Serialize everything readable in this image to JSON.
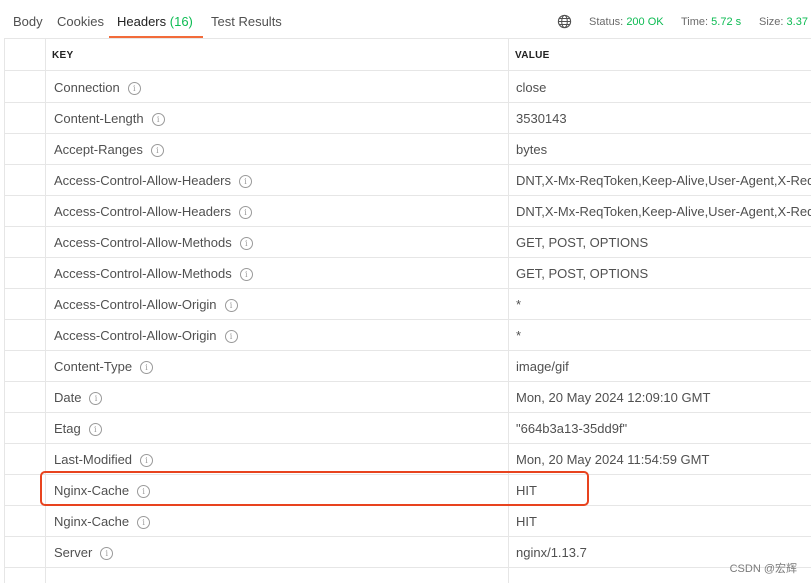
{
  "tabs": {
    "body": "Body",
    "cookies": "Cookies",
    "headers": "Headers",
    "headers_count": "(16)",
    "test_results": "Test Results"
  },
  "status": {
    "status_label": "Status:",
    "status_value": "200 OK",
    "time_label": "Time:",
    "time_value": "5.72 s",
    "size_label": "Size:",
    "size_value": "3.37"
  },
  "table": {
    "key_header": "KEY",
    "value_header": "VALUE",
    "rows": [
      {
        "key": "Connection",
        "value": "close"
      },
      {
        "key": "Content-Length",
        "value": "3530143"
      },
      {
        "key": "Accept-Ranges",
        "value": "bytes"
      },
      {
        "key": "Access-Control-Allow-Headers",
        "value": "DNT,X-Mx-ReqToken,Keep-Alive,User-Agent,X-Reques"
      },
      {
        "key": "Access-Control-Allow-Headers",
        "value": "DNT,X-Mx-ReqToken,Keep-Alive,User-Agent,X-Reques"
      },
      {
        "key": "Access-Control-Allow-Methods",
        "value": "GET, POST, OPTIONS"
      },
      {
        "key": "Access-Control-Allow-Methods",
        "value": "GET, POST, OPTIONS"
      },
      {
        "key": "Access-Control-Allow-Origin",
        "value": "*"
      },
      {
        "key": "Access-Control-Allow-Origin",
        "value": "*"
      },
      {
        "key": "Content-Type",
        "value": "image/gif"
      },
      {
        "key": "Date",
        "value": "Mon, 20 May 2024 12:09:10 GMT"
      },
      {
        "key": "Etag",
        "value": "\"664b3a13-35dd9f\""
      },
      {
        "key": "Last-Modified",
        "value": "Mon, 20 May 2024 11:54:59 GMT"
      },
      {
        "key": "Nginx-Cache",
        "value": "HIT"
      },
      {
        "key": "Nginx-Cache",
        "value": "HIT"
      },
      {
        "key": "Server",
        "value": "nginx/1.13.7"
      }
    ]
  },
  "colors": {
    "accent": "#f26b3a",
    "success": "#0cbb52",
    "highlight_border": "#e8431e"
  },
  "icons": {
    "globe": "globe-icon",
    "info": "info-icon"
  },
  "watermark": "CSDN @宏辉"
}
